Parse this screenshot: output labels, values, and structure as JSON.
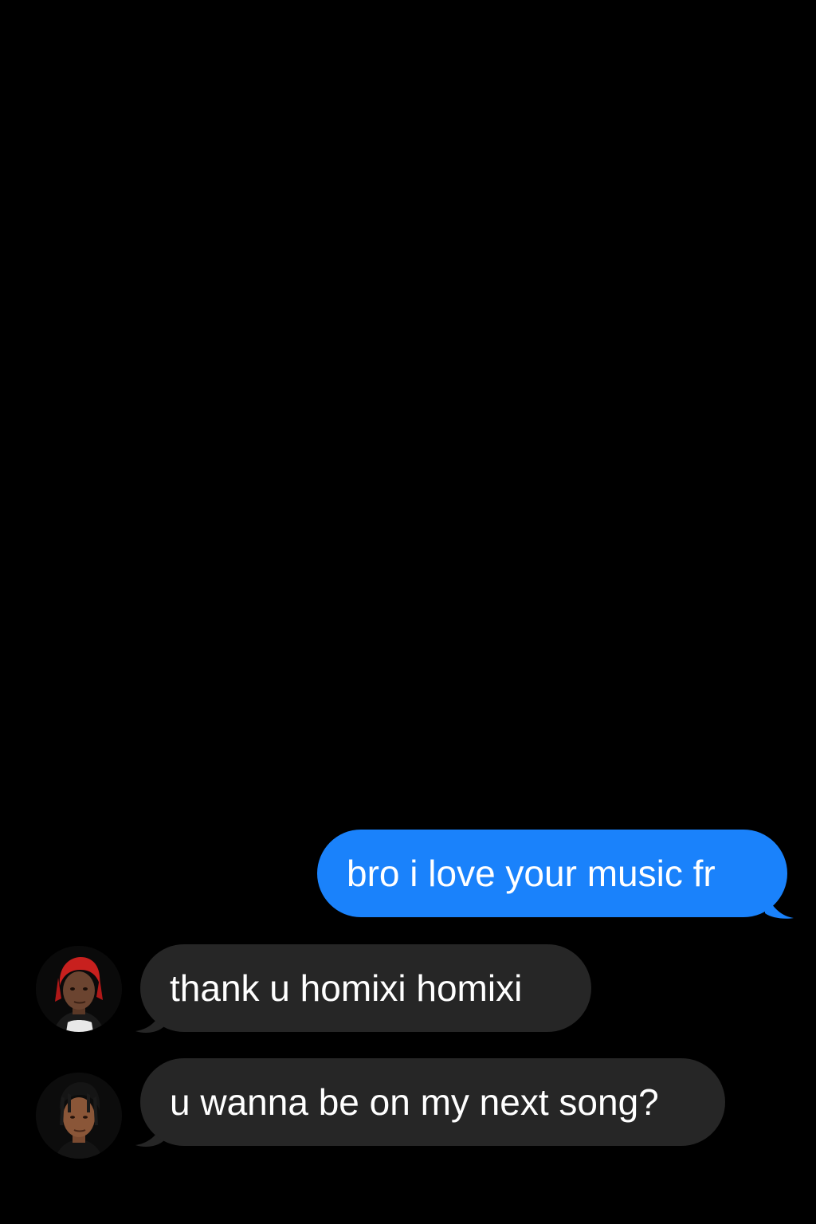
{
  "colors": {
    "background": "#000000",
    "outgoing_bubble": "#1a82fb",
    "incoming_bubble": "#262626",
    "text": "#ffffff"
  },
  "messages": [
    {
      "direction": "outgoing",
      "text": "bro i love your music fr"
    },
    {
      "direction": "incoming",
      "text": "thank u homixi homixi",
      "avatar": "contact-avatar-red-hair"
    },
    {
      "direction": "incoming",
      "text": "u wanna be on my next song?",
      "avatar": "contact-avatar-dreadlocks"
    }
  ]
}
